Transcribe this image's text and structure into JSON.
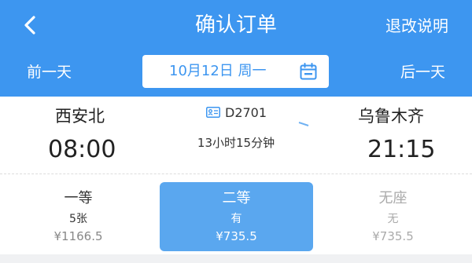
{
  "header": {
    "title": "确认订单",
    "rules_link": "退改说明",
    "back_icon": "chevron-left-icon",
    "prev_day": "前一天",
    "next_day": "后一天",
    "date": "10月12日 周一",
    "calendar_icon": "calendar-icon",
    "bg_color": "#3d96f0"
  },
  "train": {
    "from_station": "西安北",
    "to_station": "乌鲁木齐",
    "depart_time": "08:00",
    "arrive_time": "21:15",
    "number": "D2701",
    "duration": "13小时15分钟"
  },
  "seats": [
    {
      "name": "一等",
      "availability": "5张",
      "price": "¥1166.5",
      "selected": false
    },
    {
      "name": "二等",
      "availability": "有",
      "price": "¥735.5",
      "selected": true
    },
    {
      "name": "无座",
      "availability": "无",
      "price": "¥735.5",
      "selected": false
    }
  ]
}
